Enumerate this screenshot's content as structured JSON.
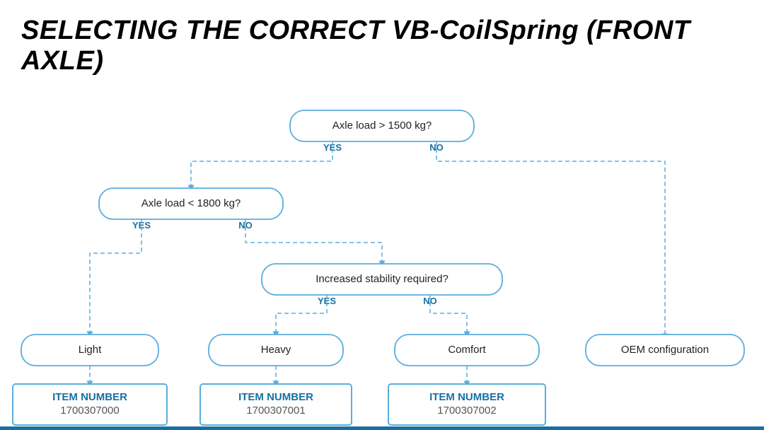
{
  "title": "SELECTING THE CORRECT VB-CoilSpring (FRONT AXLE)",
  "nodes": {
    "q1": {
      "label": "Axle load > 1500 kg?",
      "yes": "YES",
      "no": "NO"
    },
    "q2": {
      "label": "Axle load < 1800 kg?",
      "yes": "YES",
      "no": "NO"
    },
    "q3": {
      "label": "Increased stability required?",
      "yes": "YES",
      "no": "NO"
    }
  },
  "results": {
    "light": "Light",
    "heavy": "Heavy",
    "comfort": "Comfort",
    "oem": "OEM configuration"
  },
  "items": {
    "item0": {
      "label": "ITEM NUMBER",
      "value": "1700307000"
    },
    "item1": {
      "label": "ITEM NUMBER",
      "value": "1700307001"
    },
    "item2": {
      "label": "ITEM NUMBER",
      "value": "1700307002"
    }
  }
}
